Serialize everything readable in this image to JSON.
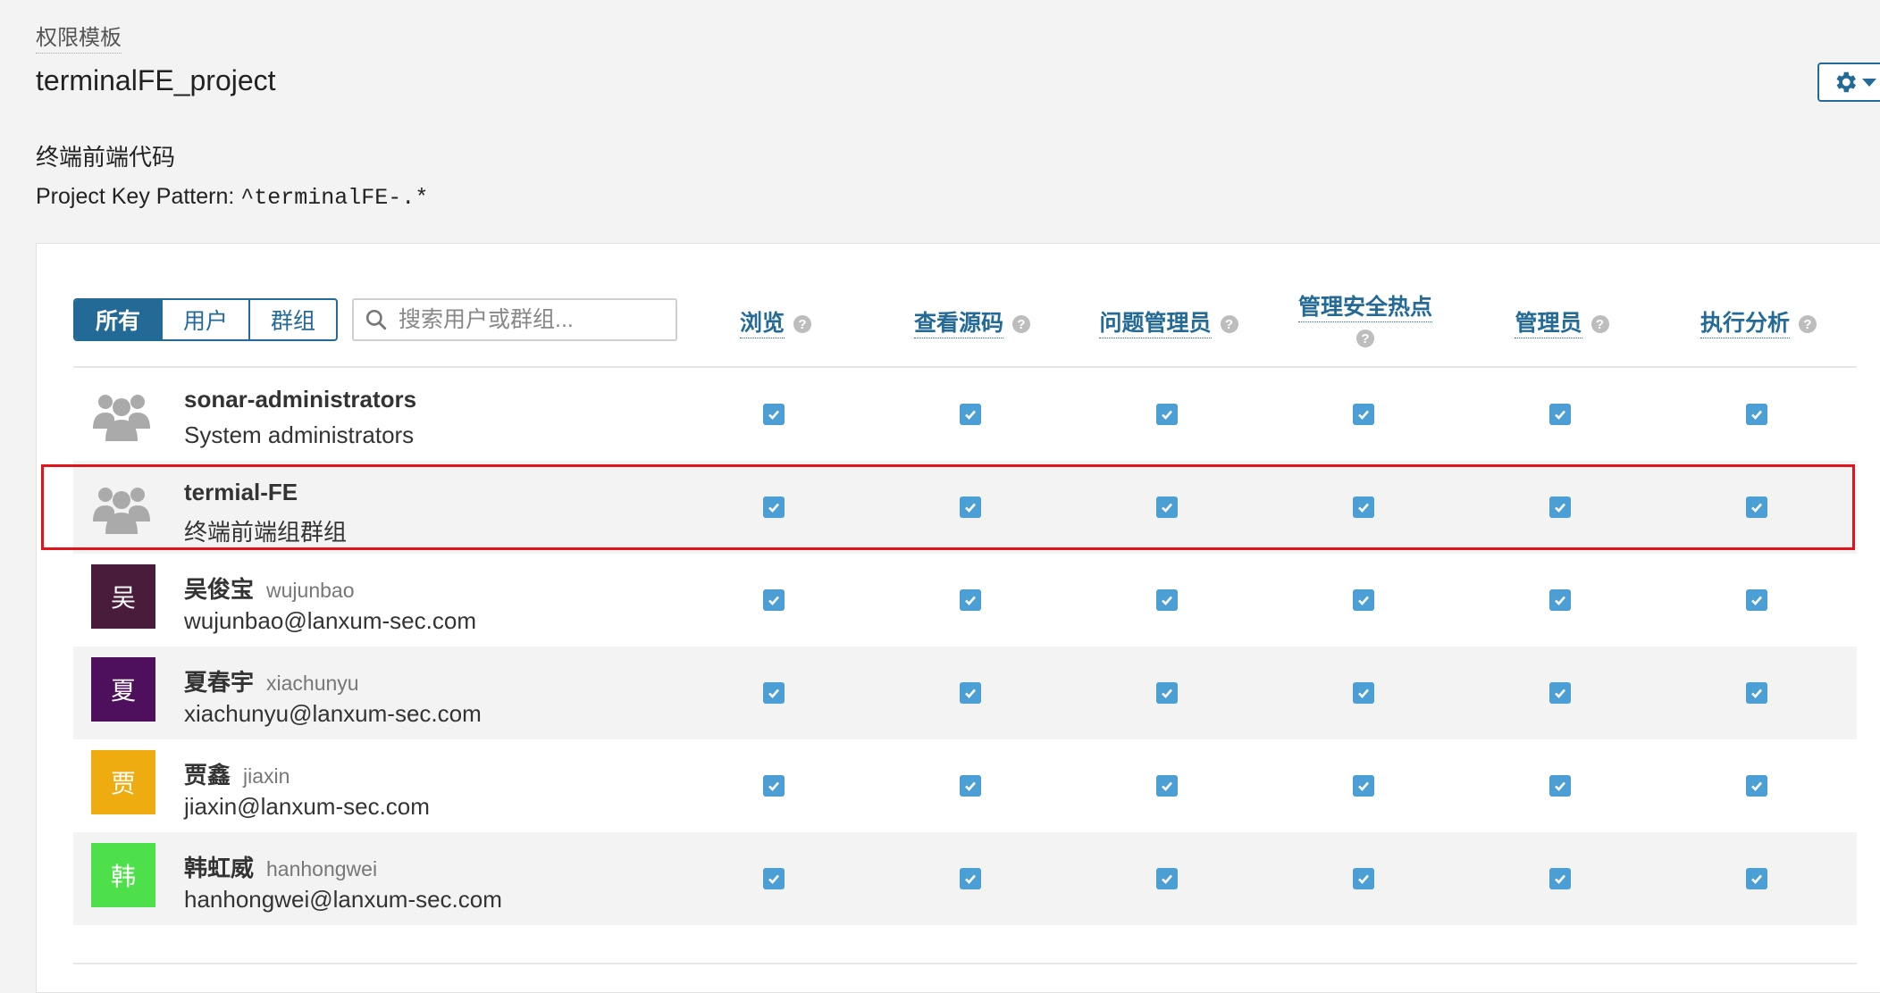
{
  "breadcrumb": "权限模板",
  "page_title": "terminalFE_project",
  "description": "终端前端代码",
  "key_pattern": {
    "label": "Project Key Pattern: ",
    "value": "^terminalFE-.*"
  },
  "filters": {
    "all": "所有",
    "users": "用户",
    "groups": "群组"
  },
  "search": {
    "placeholder": "搜索用户或群组..."
  },
  "columns": [
    {
      "label": "浏览"
    },
    {
      "label": "查看源码"
    },
    {
      "label": "问题管理员"
    },
    {
      "label": "管理安全热点"
    },
    {
      "label": "管理员"
    },
    {
      "label": "执行分析"
    }
  ],
  "rows": [
    {
      "type": "group",
      "name": "sonar-administrators",
      "subtitle": "System administrators",
      "permissions": [
        true,
        true,
        true,
        true,
        true,
        true
      ]
    },
    {
      "type": "group",
      "name": "termial-FE",
      "subtitle": "终端前端组群组",
      "permissions": [
        true,
        true,
        true,
        true,
        true,
        true
      ],
      "highlighted": true
    },
    {
      "type": "user",
      "initial": "吴",
      "avatar_color": "#4a1c3c",
      "name": "吴俊宝",
      "login": "wujunbao",
      "email": "wujunbao@lanxum-sec.com",
      "permissions": [
        true,
        true,
        true,
        true,
        true,
        true
      ]
    },
    {
      "type": "user",
      "initial": "夏",
      "avatar_color": "#4e0f5c",
      "name": "夏春宇",
      "login": "xiachunyu",
      "email": "xiachunyu@lanxum-sec.com",
      "permissions": [
        true,
        true,
        true,
        true,
        true,
        true
      ]
    },
    {
      "type": "user",
      "initial": "贾",
      "avatar_color": "#eeac10",
      "name": "贾鑫",
      "login": "jiaxin",
      "email": "jiaxin@lanxum-sec.com",
      "permissions": [
        true,
        true,
        true,
        true,
        true,
        true
      ]
    },
    {
      "type": "user",
      "initial": "韩",
      "avatar_color": "#4ee04a",
      "name": "韩虹威",
      "login": "hanhongwei",
      "email": "hanhongwei@lanxum-sec.com",
      "permissions": [
        true,
        true,
        true,
        true,
        true,
        true
      ]
    }
  ],
  "colors": {
    "accent": "#236a97",
    "checkbox": "#4b9fd5",
    "highlight": "#e0141a"
  },
  "icons": {
    "settings": "gear-icon",
    "search": "search-icon",
    "help": "help-icon",
    "group": "group-icon",
    "checked": "checkbox-checked-icon"
  }
}
